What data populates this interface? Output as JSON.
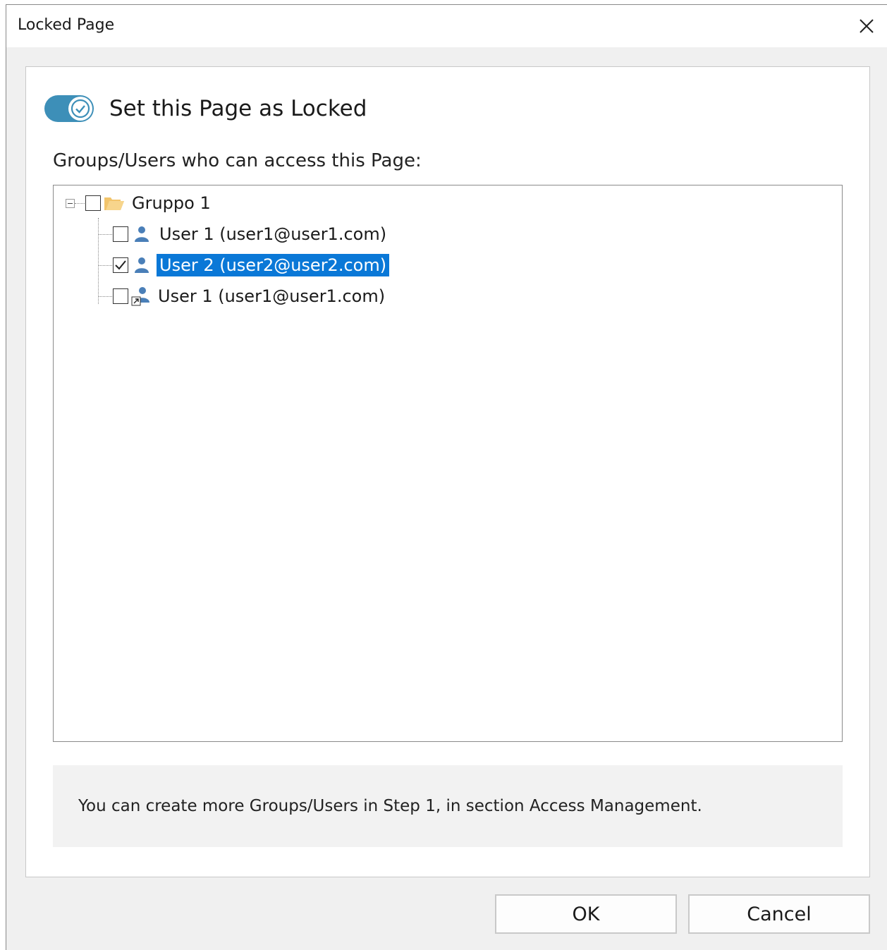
{
  "window": {
    "title": "Locked Page"
  },
  "lock_toggle": {
    "label": "Set this Page as Locked",
    "on": true,
    "color": "#3d8fb8"
  },
  "access": {
    "label": "Groups/Users who can access this Page:",
    "tree": {
      "group": {
        "label": "Gruppo 1",
        "checked": false,
        "expanded": true,
        "icon": "folder-icon"
      },
      "users": [
        {
          "label": "User 1 (user1@user1.com)",
          "checked": false,
          "selected": false,
          "icon": "user-icon"
        },
        {
          "label": "User 2 (user2@user2.com)",
          "checked": true,
          "selected": true,
          "icon": "user-icon"
        },
        {
          "label": "User 1 (user1@user1.com)",
          "checked": false,
          "selected": false,
          "icon": "user-shortcut-icon"
        }
      ]
    }
  },
  "info": {
    "text": "You can create more Groups/Users in Step 1, in section Access Management."
  },
  "buttons": {
    "ok": "OK",
    "cancel": "Cancel"
  },
  "colors": {
    "selection": "#0a78d7",
    "folder": "#f2c46b",
    "user": "#4a7fb8"
  }
}
